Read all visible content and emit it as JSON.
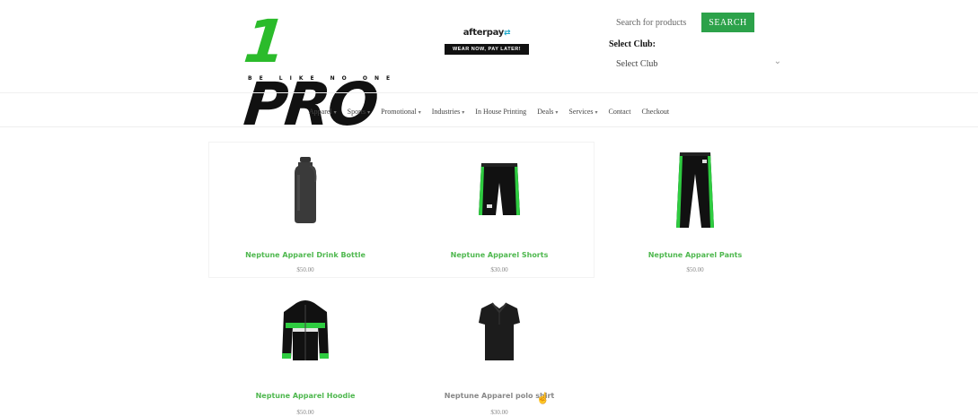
{
  "header": {
    "logo_one": "1",
    "logo_pro": "PRO",
    "logo_tagline": "BE LIKE NO ONE",
    "afterpay_logo": "afterpay",
    "afterpay_mark": "⇄",
    "afterpay_pill": "WEAR NOW, PAY LATER!",
    "search_placeholder": "Search for products",
    "search_button": "SEARCH",
    "club_label": "Select Club:",
    "club_value": "Select Club"
  },
  "nav": [
    {
      "label": "Apparel",
      "caret": true
    },
    {
      "label": "Sports",
      "caret": true
    },
    {
      "label": "Promotional",
      "caret": true
    },
    {
      "label": "Industries",
      "caret": true
    },
    {
      "label": "In House Printing",
      "caret": false
    },
    {
      "label": "Deals",
      "caret": true
    },
    {
      "label": "Services",
      "caret": true
    },
    {
      "label": "Contact",
      "caret": false
    },
    {
      "label": "Checkout",
      "caret": false
    }
  ],
  "products": [
    {
      "title": "Neptune Apparel Drink Bottle",
      "price": "$50.00",
      "icon": "drink-bottle-icon"
    },
    {
      "title": "Neptune Apparel Shorts",
      "price": "$30.00",
      "icon": "shorts-icon"
    },
    {
      "title": "Neptune Apparel Pants",
      "price": "$50.00",
      "icon": "pants-icon"
    },
    {
      "title": "Neptune Apparel Hoodie",
      "price": "$50.00",
      "icon": "hoodie-icon"
    },
    {
      "title": "Neptune Apparel polo shirt",
      "price": "$30.00",
      "icon": "polo-shirt-icon"
    }
  ],
  "colors": {
    "brand_green": "#2bbb2b",
    "button_green": "#2ca24a",
    "title_green": "#4fb84f"
  }
}
